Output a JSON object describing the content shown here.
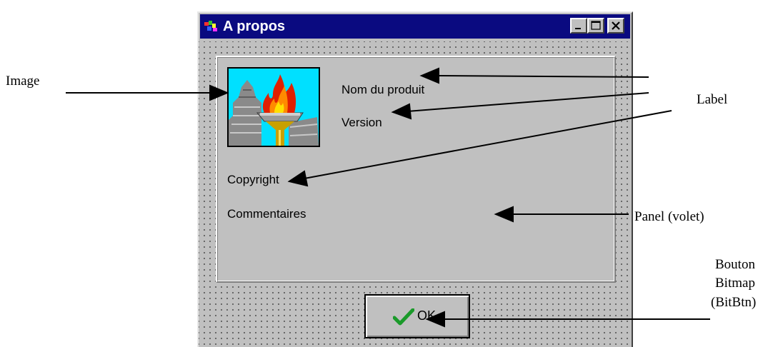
{
  "window": {
    "title": "A propos",
    "controls": {
      "minimize": "minimize-icon",
      "maximize": "maximize-icon",
      "close": "close-icon"
    }
  },
  "panel": {
    "image": {
      "icon": "olympic-torch-image"
    },
    "labels": {
      "product_name": "Nom du produit",
      "version": "Version",
      "copyright": "Copyright",
      "comments": "Commentaires"
    }
  },
  "ok_button": {
    "label": "OK",
    "icon": "checkmark-icon"
  },
  "annotations": {
    "image": "Image",
    "label": "Label",
    "panel": "Panel (volet)",
    "bitbtn_line1": "Bouton",
    "bitbtn_line2": "Bitmap",
    "bitbtn_line3": "(BitBtn)"
  },
  "colors": {
    "titlebar": "#0a0a80",
    "face": "#c0c0c0",
    "image_background": "#00e0ff",
    "checkmark": "#1a9a2a"
  }
}
